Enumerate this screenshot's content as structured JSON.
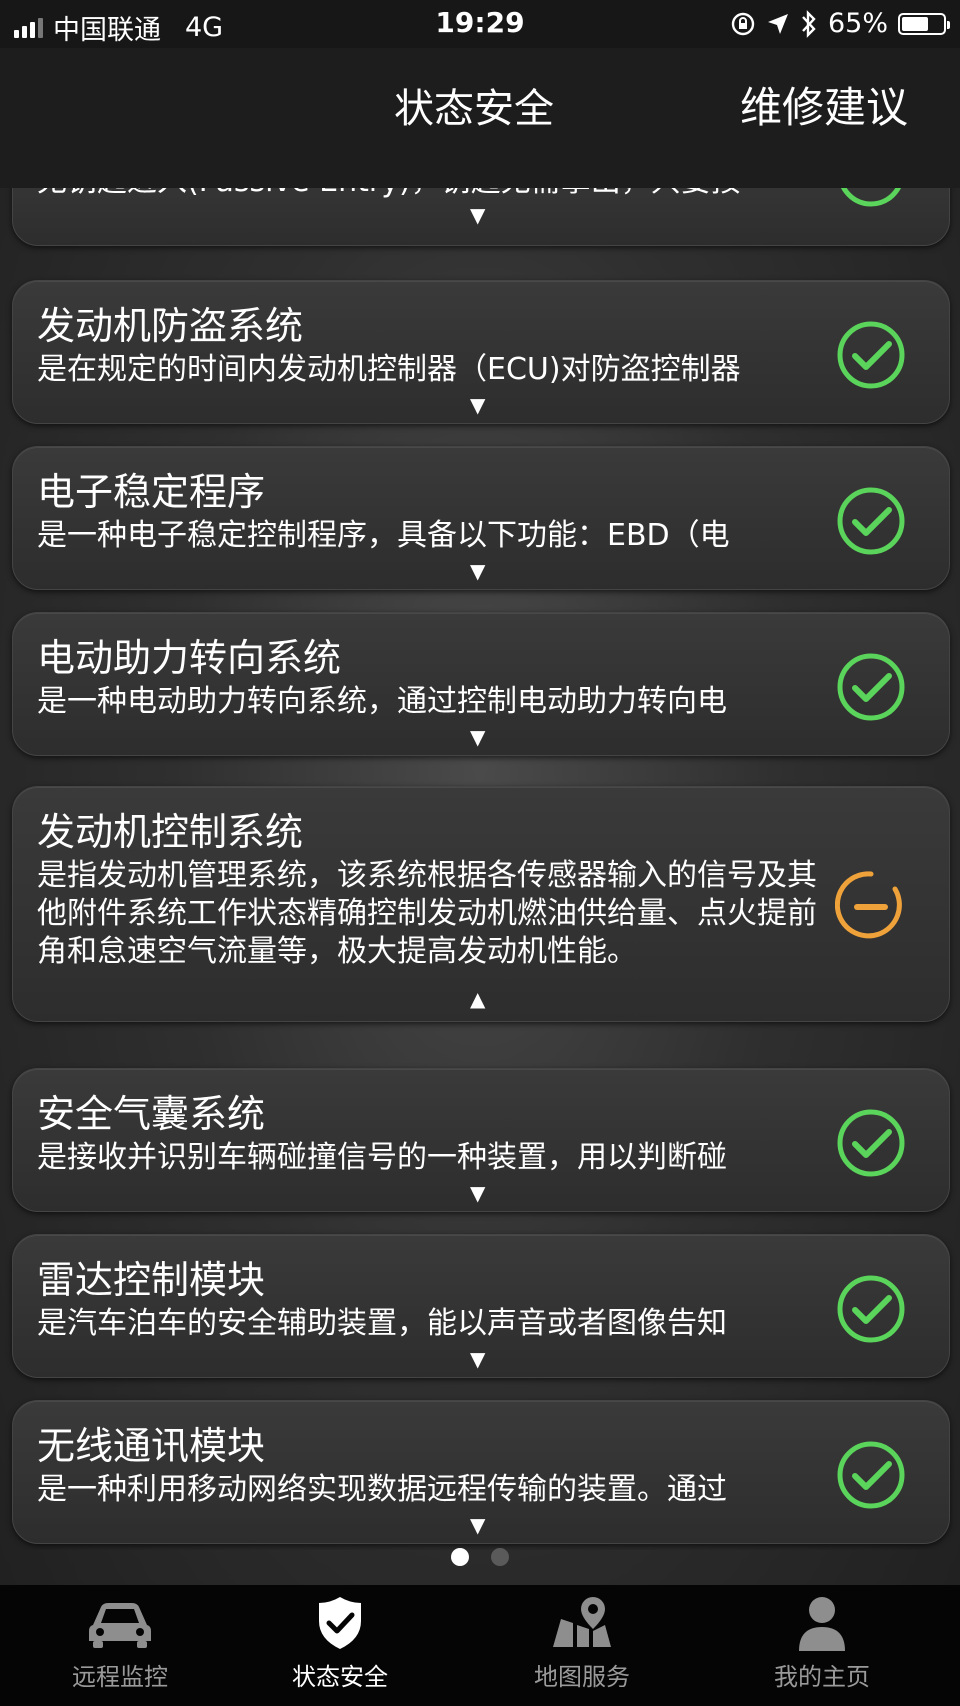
{
  "status_bar": {
    "carrier": "中国联通",
    "network": "4G",
    "time": "19:29",
    "battery": "65%",
    "battery_level": 0.65
  },
  "header": {
    "tab_status": "状态安全",
    "tab_advice": "维修建议"
  },
  "cards": [
    {
      "title": "",
      "desc": "无钥匙进入(Passive Entry)，钥匙无需拿出，只要按",
      "status": "ok",
      "expanded": false
    },
    {
      "title": "发动机防盗系统",
      "desc": "是在规定的时间内发动机控制器（ECU)对防盗控制器",
      "status": "ok",
      "expanded": false
    },
    {
      "title": "电子稳定程序",
      "desc": "是一种电子稳定控制程序，具备以下功能：EBD（电",
      "status": "ok",
      "expanded": false
    },
    {
      "title": "电动助力转向系统",
      "desc": "是一种电动助力转向系统，通过控制电动助力转向电",
      "status": "ok",
      "expanded": false
    },
    {
      "title": "发动机控制系统",
      "desc": "是指发动机管理系统，该系统根据各传感器输入的信号及其他附件系统工作状态精确控制发动机燃油供给量、点火提前角和怠速空气流量等，极大提高发动机性能。",
      "status": "warning",
      "expanded": true
    },
    {
      "title": "安全气囊系统",
      "desc": "是接收并识别车辆碰撞信号的一种装置，用以判断碰",
      "status": "ok",
      "expanded": false
    },
    {
      "title": "雷达控制模块",
      "desc": "是汽车泊车的安全辅助装置，能以声音或者图像告知",
      "status": "ok",
      "expanded": false
    },
    {
      "title": "无线通讯模块",
      "desc": "是一种利用移动网络实现数据远程传输的装置。通过",
      "status": "ok",
      "expanded": false
    }
  ],
  "arrows": {
    "collapsed": "▼",
    "expanded": "▲"
  },
  "pagination": {
    "pages": 2,
    "current": 1
  },
  "tabbar": {
    "items": [
      {
        "label": "远程监控",
        "icon": "car-icon"
      },
      {
        "label": "状态安全",
        "icon": "shield-check-icon"
      },
      {
        "label": "地图服务",
        "icon": "map-pin-icon"
      },
      {
        "label": "我的主页",
        "icon": "user-icon"
      }
    ],
    "active_index": 1
  },
  "colors": {
    "ok": "#5ad45a",
    "warning": "#f0a23a",
    "background": "#2f2f2f"
  }
}
